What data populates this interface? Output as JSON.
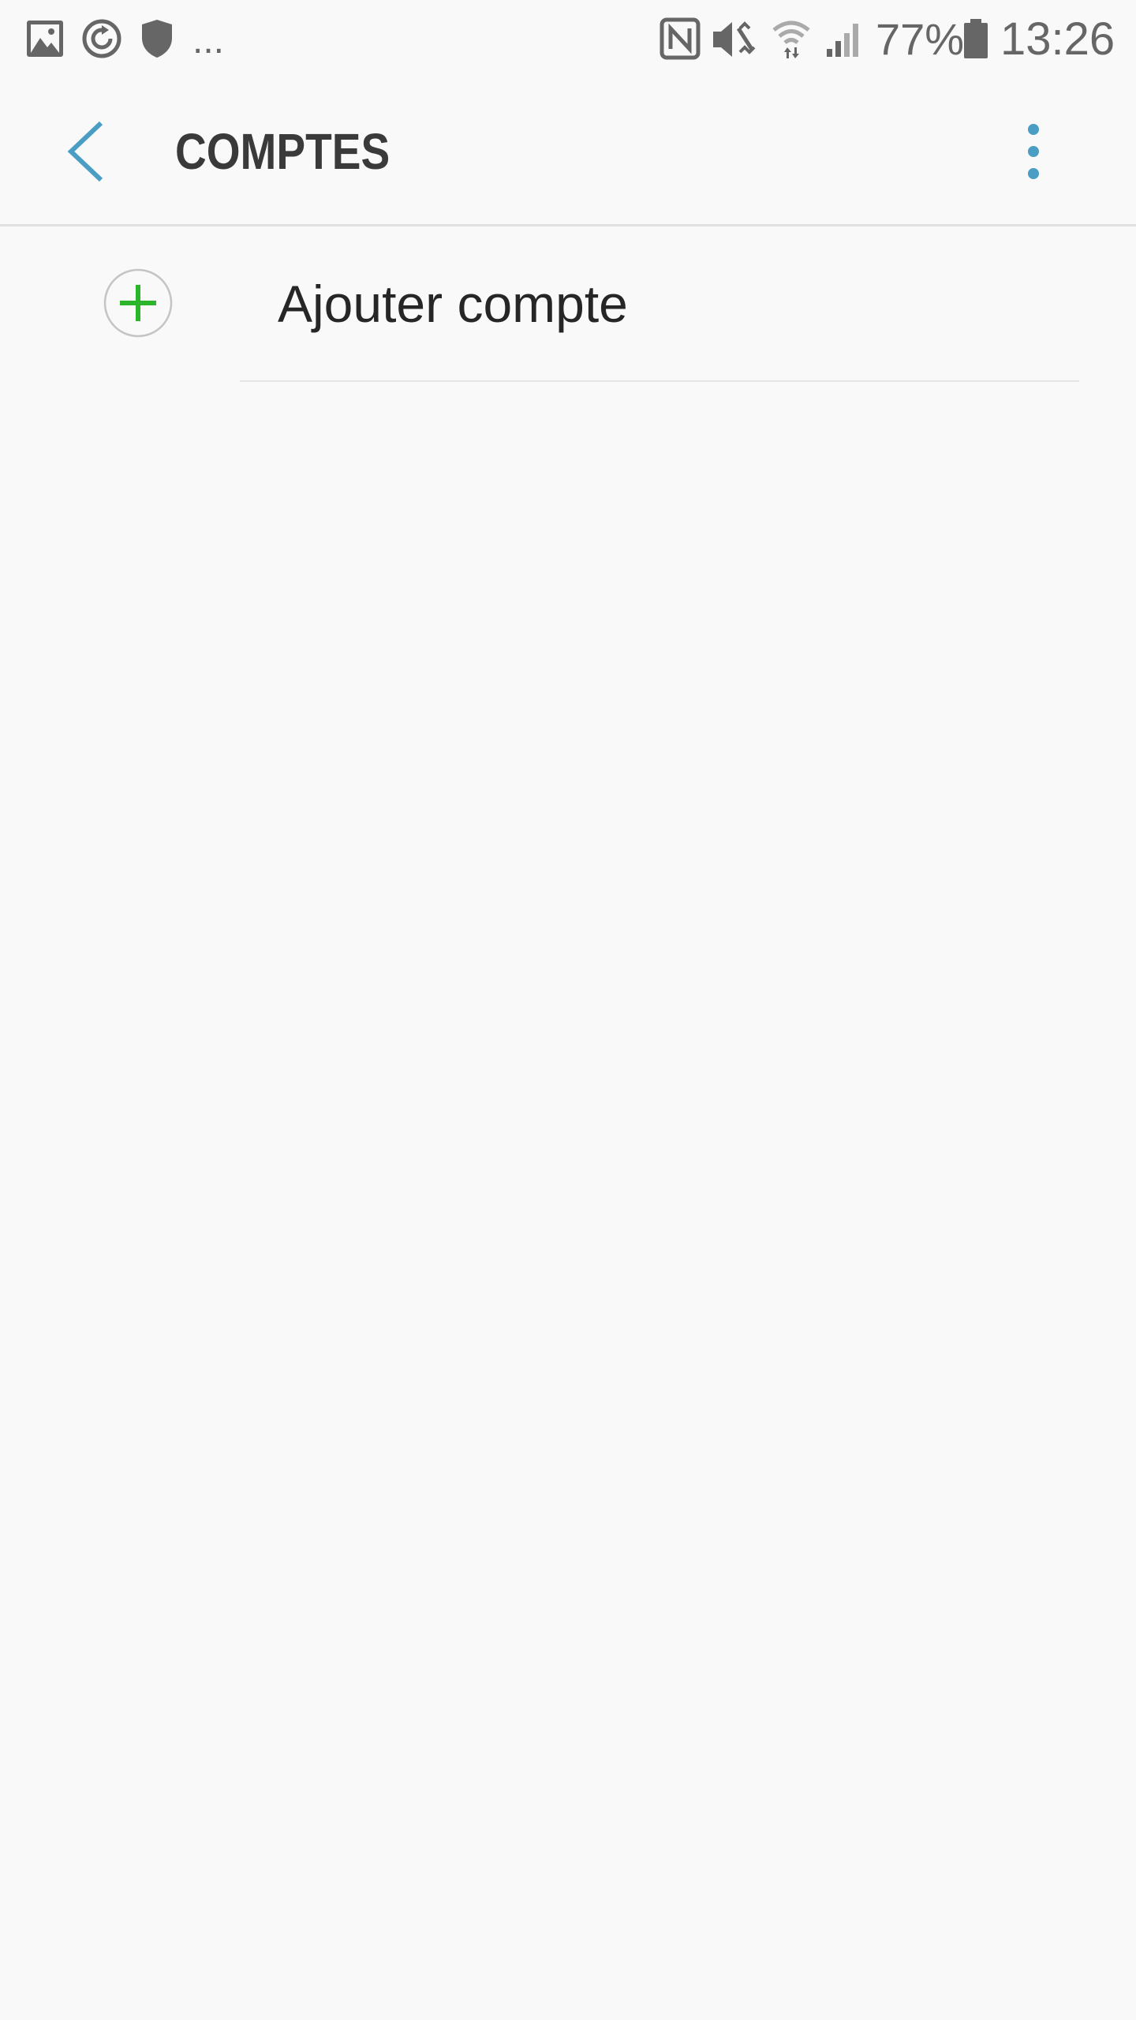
{
  "status_bar": {
    "battery_percent": "77%",
    "time": "13:26",
    "notification_overflow": "...",
    "icons": [
      "gallery-icon",
      "sync-icon",
      "shield-icon",
      "nfc-icon",
      "vibrate-icon",
      "wifi-icon",
      "signal-icon",
      "battery-icon"
    ]
  },
  "header": {
    "title": "COMPTES",
    "back_icon": "chevron-left-icon",
    "menu_icon": "more-vertical-icon"
  },
  "list": {
    "items": [
      {
        "label": "Ajouter compte",
        "icon": "add-circle-icon"
      }
    ]
  },
  "colors": {
    "background": "#f9f9f9",
    "accent": "#4a9ec4",
    "add_green": "#2bb52b",
    "title_text": "#3a3a3a",
    "status_icons": "#666666"
  }
}
